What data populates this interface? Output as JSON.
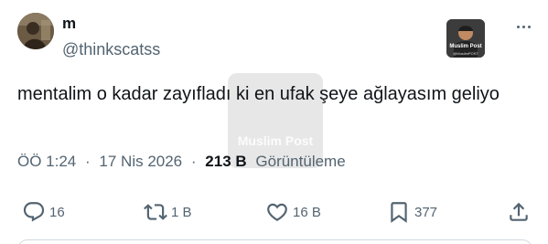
{
  "author": {
    "display_name": "m",
    "handle": "@thinkscatss"
  },
  "badge": {
    "title": "Muslim Post",
    "subtitle": "@MuslimPOST"
  },
  "watermark": {
    "text": "Muslim Post"
  },
  "tweet": {
    "text": "mentalim o kadar zayıfladı ki en ufak şeye ağlayasım geliyo"
  },
  "meta": {
    "time": "ÖÖ 1:24",
    "separator": "·",
    "date": "17 Nis 2026",
    "separator2": "·",
    "views_count": "213 B",
    "views_label": "Görüntüleme"
  },
  "actions": {
    "replies": "16",
    "reposts": "1 B",
    "likes": "16 B",
    "bookmarks": "377"
  },
  "icons": {
    "reply": "reply-icon",
    "repost": "repost-icon",
    "like": "heart-icon",
    "bookmark": "bookmark-icon",
    "share": "share-icon",
    "more": "more-icon"
  },
  "colors": {
    "text_primary": "#0f1419",
    "text_secondary": "#536471",
    "border": "#cfd9de"
  }
}
